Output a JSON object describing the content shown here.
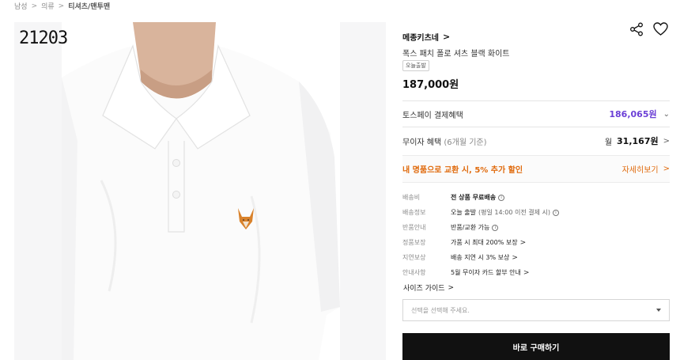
{
  "breadcrumb": {
    "items": [
      "남성",
      "의류",
      "티셔츠/맨투맨"
    ]
  },
  "image": {
    "watermark": "21203"
  },
  "product": {
    "brand": "메종키츠네",
    "name": "폭스 패치 폴로 셔츠 블랙 화이트",
    "badge": "오늘출발",
    "price": "187,000원"
  },
  "icons": {
    "share": "share-icon",
    "like": "heart-icon",
    "chevron": "chevron-right-icon"
  },
  "benefits": {
    "toss_label": "토스페이 결제혜택",
    "toss_price": "186,065원",
    "interest_label": "무이자 혜택",
    "interest_period": "(6개월 기준)",
    "interest_prefix": "월",
    "interest_amount": "31,167원"
  },
  "promo": {
    "text": "내 명품으로 교환 시, 5% 추가 할인",
    "link": "자세히보기"
  },
  "details": [
    {
      "key": "배송비",
      "value": "전 상품 무료배송",
      "note": "",
      "icon": "info-icon"
    },
    {
      "key": "배송정보",
      "value": "오늘 출발",
      "note": "(평일 14:00 이전 결제 시)",
      "icon": "info-icon"
    },
    {
      "key": "반품안내",
      "value": "반품/교환 가능",
      "note": "",
      "icon": "info-icon"
    },
    {
      "key": "정품보장",
      "value": "가품 시 최대 200% 보장",
      "note": "",
      "icon": "chevron-right-icon"
    },
    {
      "key": "지연보상",
      "value": "배송 지연 시 3% 보상",
      "note": "",
      "icon": "chevron-right-icon"
    },
    {
      "key": "안내사항",
      "value": "5월 무이자 카드 할부 안내",
      "note": "",
      "icon": "chevron-right-icon"
    }
  ],
  "size_guide": "사이즈 가이드",
  "option_select": {
    "placeholder": "선택을 선택해 주세요."
  },
  "buy_button": "바로 구매하기",
  "colors": {
    "accent_purple": "#6b3fd6",
    "promo_orange": "#e06a0c",
    "button_dark": "#111111"
  }
}
